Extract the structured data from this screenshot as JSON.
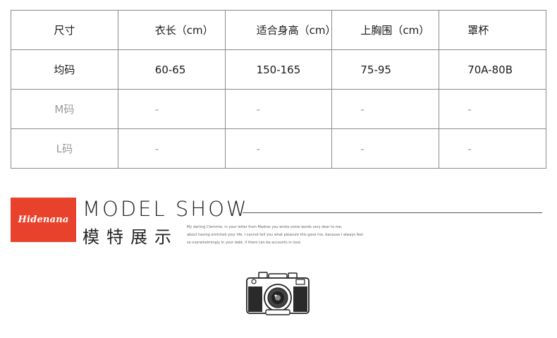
{
  "size_table": {
    "header": [
      "尺寸",
      "衣长（cm）",
      "适合身高（cm）",
      "上胸围（cm）",
      "罩杯"
    ],
    "rows": [
      [
        "均码",
        "60-65",
        "150-165",
        "75-95",
        "70A-80B"
      ],
      [
        "M码",
        "-",
        "-",
        "-",
        "-"
      ],
      [
        "L码",
        "-",
        "-",
        "-",
        "-"
      ]
    ]
  },
  "brand": {
    "logo_text": "Hidenana"
  },
  "model_show": {
    "title": "MODEL SHOW",
    "subtitle_cn": "模特展示",
    "paragraph": [
      "My darling Clemmie, in your letter from Madras you wrote some words very dear to me,",
      "about having enriched your life. I cannot tell you what pleasure this gave me, because I always feel",
      "so overwhelmingly in your debt, if there can be accounts in love."
    ]
  },
  "colors": {
    "logo_bg": "#e8422d",
    "border": "#8c8c8c",
    "dim_text": "#9a9a9a"
  },
  "icons": {
    "camera": "camera-icon"
  }
}
